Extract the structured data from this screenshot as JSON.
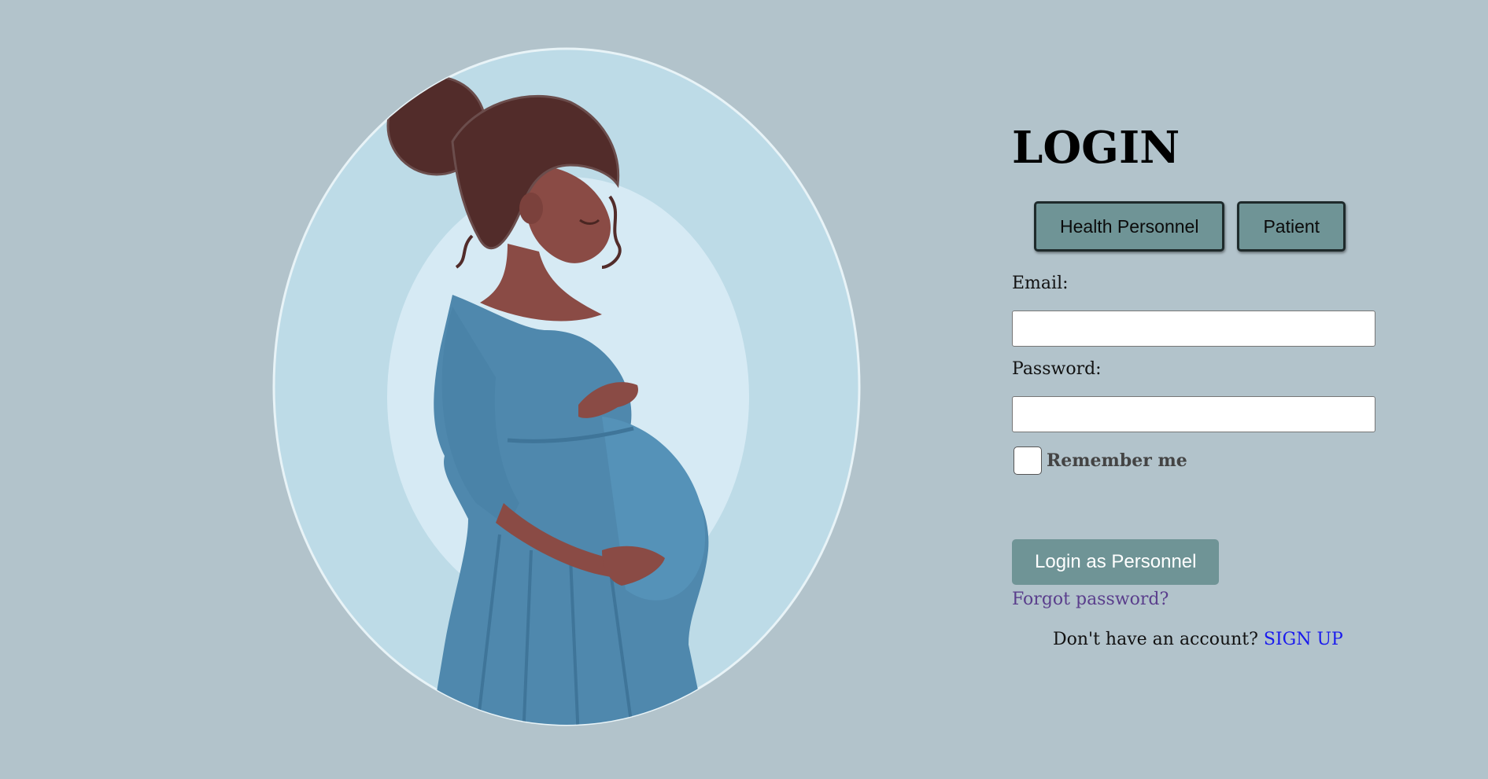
{
  "illustration": {
    "alt": "Pregnant woman illustration"
  },
  "login": {
    "title": "LOGIN",
    "roles": [
      {
        "label": "Health Personnel"
      },
      {
        "label": "Patient"
      }
    ],
    "email_label": "Email:",
    "email_value": "",
    "password_label": "Password:",
    "password_value": "",
    "remember_label": "Remember me",
    "remember_checked": false,
    "submit_label": "Login as Personnel",
    "forgot_label": "Forgot password?",
    "signup_prompt": "Don't have an account?",
    "signup_label": "SIGN UP"
  },
  "colors": {
    "background": "#b2c3cb",
    "button": "#6f9496",
    "forgot_link": "#5a3e8c",
    "signup_link": "#1a1aee"
  }
}
